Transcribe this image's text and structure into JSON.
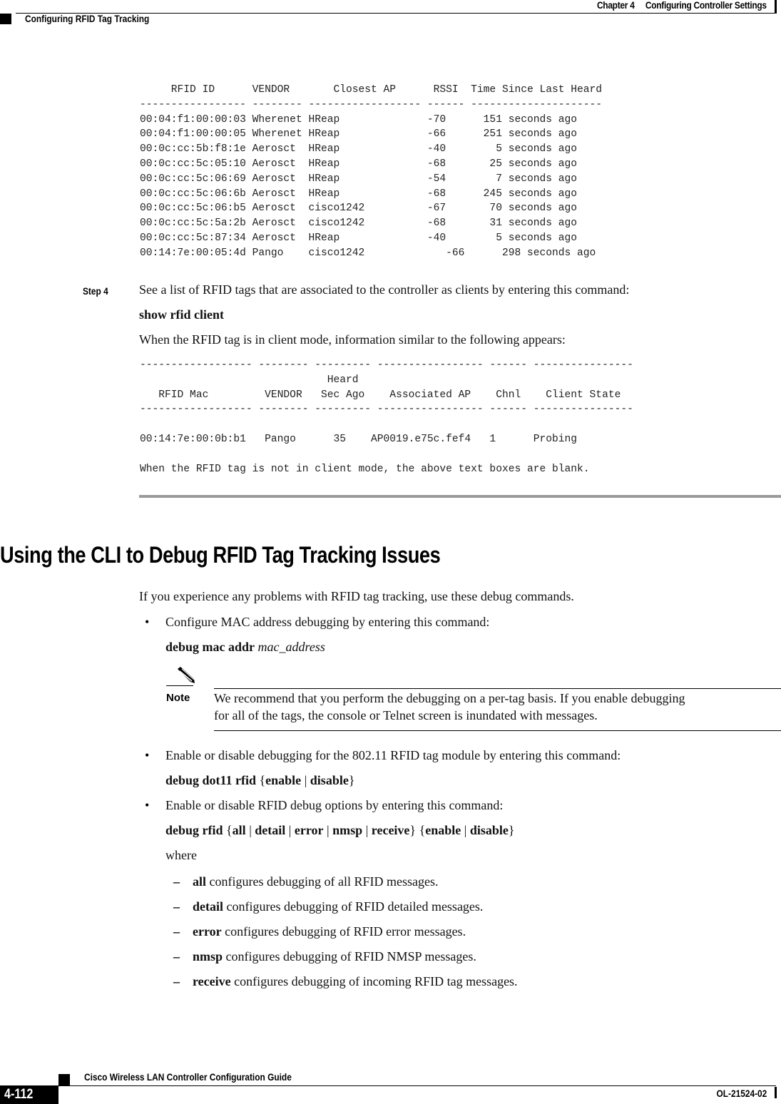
{
  "header": {
    "chapter": "Chapter 4",
    "chapter_title": "Configuring Controller Settings",
    "section": "Configuring RFID Tag Tracking"
  },
  "rfid_summary": {
    "columns": [
      "RFID ID",
      "VENDOR",
      "Closest AP",
      "RSSI",
      "Time Since Last Heard"
    ],
    "header_line": "     RFID ID      VENDOR       Closest AP      RSSI  Time Since Last Heard",
    "separator_line": "----------------- -------- ------------------ ------ ---------------------",
    "rows": [
      {
        "rfid_id": "00:04:f1:00:00:03",
        "vendor": "Wherenet",
        "closest_ap": "HReap",
        "rssi": "-70",
        "time": "151 seconds ago"
      },
      {
        "rfid_id": "00:04:f1:00:00:05",
        "vendor": "Wherenet",
        "closest_ap": "HReap",
        "rssi": "-66",
        "time": "251 seconds ago"
      },
      {
        "rfid_id": "00:0c:cc:5b:f8:1e",
        "vendor": "Aerosct",
        "closest_ap": "HReap",
        "rssi": "-40",
        "time": "5 seconds ago"
      },
      {
        "rfid_id": "00:0c:cc:5c:05:10",
        "vendor": "Aerosct",
        "closest_ap": "HReap",
        "rssi": "-68",
        "time": "25 seconds ago"
      },
      {
        "rfid_id": "00:0c:cc:5c:06:69",
        "vendor": "Aerosct",
        "closest_ap": "HReap",
        "rssi": "-54",
        "time": "7 seconds ago"
      },
      {
        "rfid_id": "00:0c:cc:5c:06:6b",
        "vendor": "Aerosct",
        "closest_ap": "HReap",
        "rssi": "-68",
        "time": "245 seconds ago"
      },
      {
        "rfid_id": "00:0c:cc:5c:06:b5",
        "vendor": "Aerosct",
        "closest_ap": "cisco1242",
        "rssi": "-67",
        "time": "70 seconds ago"
      },
      {
        "rfid_id": "00:0c:cc:5c:5a:2b",
        "vendor": "Aerosct",
        "closest_ap": "cisco1242",
        "rssi": "-68",
        "time": "31 seconds ago"
      },
      {
        "rfid_id": "00:0c:cc:5c:87:34",
        "vendor": "Aerosct",
        "closest_ap": "HReap",
        "rssi": "-40",
        "time": "5 seconds ago"
      },
      {
        "rfid_id": "00:14:7e:00:05:4d",
        "vendor": "Pango",
        "closest_ap": "cisco1242",
        "rssi": "-66",
        "time": "298 seconds ago"
      }
    ],
    "lines": [
      "00:04:f1:00:00:03 Wherenet HReap              -70      151 seconds ago",
      "00:04:f1:00:00:05 Wherenet HReap              -66      251 seconds ago",
      "00:0c:cc:5b:f8:1e Aerosct  HReap              -40        5 seconds ago",
      "00:0c:cc:5c:05:10 Aerosct  HReap              -68       25 seconds ago",
      "00:0c:cc:5c:06:69 Aerosct  HReap              -54        7 seconds ago",
      "00:0c:cc:5c:06:6b Aerosct  HReap              -68      245 seconds ago",
      "00:0c:cc:5c:06:b5 Aerosct  cisco1242          -67       70 seconds ago",
      "00:0c:cc:5c:5a:2b Aerosct  cisco1242          -68       31 seconds ago",
      "00:0c:cc:5c:87:34 Aerosct  HReap              -40        5 seconds ago",
      "00:14:7e:00:05:4d Pango    cisco1242             -66      298 seconds ago"
    ]
  },
  "step4": {
    "label": "Step 4",
    "text": "See a list of RFID tags that are associated to the controller as clients by entering this command:",
    "command": "show rfid client",
    "followup": "When the RFID tag is in client mode, information similar to the following appears:"
  },
  "rfid_client": {
    "columns": [
      "RFID Mac",
      "VENDOR",
      "Heard Sec Ago",
      "Associated AP",
      "Chnl",
      "Client State"
    ],
    "separator_line": "------------------ -------- --------- ----------------- ------ ----------------",
    "header_line_1": "                              Heard",
    "header_line_2": "   RFID Mac         VENDOR   Sec Ago    Associated AP    Chnl    Client State",
    "rows": [
      {
        "rfid_mac": "00:14:7e:00:0b:b1",
        "vendor": "Pango",
        "heard_sec_ago": "35",
        "associated_ap": "AP0019.e75c.fef4",
        "chnl": "1",
        "client_state": "Probing"
      }
    ],
    "row_line": "00:14:7e:00:0b:b1   Pango      35    AP0019.e75c.fef4   1      Probing",
    "note_line": "When the RFID tag is not in client mode, the above text boxes are blank."
  },
  "debug_section": {
    "title": "Using the CLI to Debug RFID Tag Tracking Issues",
    "intro": "If you experience any problems with RFID tag tracking, use these debug commands.",
    "bullet1": {
      "text": "Configure MAC address debugging by entering this command:",
      "command_bold": "debug mac addr",
      "command_arg": "mac_address"
    },
    "note": {
      "label": "Note",
      "line1": "We recommend that you perform the debugging on a per-tag basis. If you enable debugging",
      "line2": "for all of the tags, the console or Telnet screen is inundated with messages."
    },
    "bullet2": {
      "text": "Enable or disable debugging for the 802.11 RFID tag module by entering this command:",
      "command_bold": "debug dot11 rfid",
      "open": "{",
      "opt1": "enable",
      "sep": "|",
      "opt2": "disable",
      "close": "}"
    },
    "bullet3": {
      "text": "Enable or disable RFID debug options by entering this command:",
      "command_bold": "debug rfid",
      "open": "{",
      "sep": "|",
      "close": "}",
      "options": [
        "all",
        "detail",
        "error",
        "nmsp",
        "receive"
      ],
      "states": [
        "enable",
        "disable"
      ],
      "where": "where"
    },
    "options_desc": [
      {
        "keyword": "all",
        "desc": "configures debugging of all RFID messages."
      },
      {
        "keyword": "detail",
        "desc": "configures debugging of RFID detailed messages."
      },
      {
        "keyword": "error",
        "desc": "configures debugging of RFID error messages."
      },
      {
        "keyword": "nmsp",
        "desc": "configures debugging of RFID NMSP messages."
      },
      {
        "keyword": "receive",
        "desc": "configures debugging of incoming RFID tag messages."
      }
    ]
  },
  "footer": {
    "guide_title": "Cisco Wireless LAN Controller Configuration Guide",
    "page_number": "4-112",
    "doc_number": "OL-21524-02"
  },
  "glyphs": {
    "bullet": "•",
    "dash": "–"
  }
}
